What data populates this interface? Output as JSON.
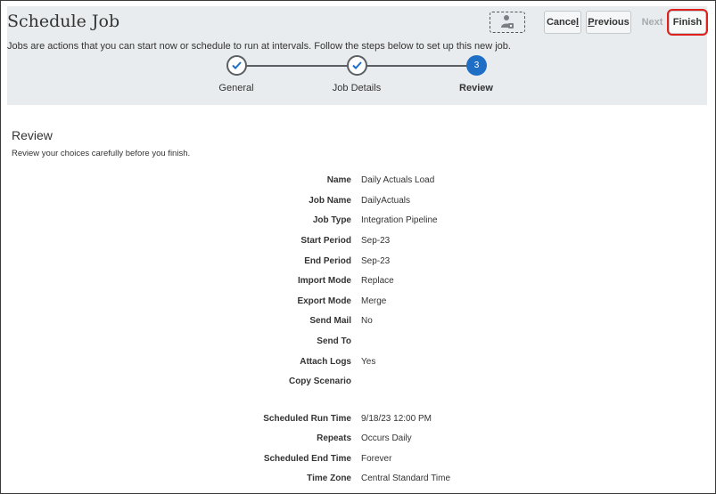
{
  "header": {
    "title": "Schedule Job",
    "description": "Jobs are actions that you can start now or schedule to run at intervals. Follow the steps below to set up this new job.",
    "context_icon": "user-lock-icon",
    "buttons": {
      "cancel": {
        "pre": "Cance",
        "key": "l"
      },
      "previous": {
        "pre": "",
        "key": "P",
        "post": "revious"
      },
      "next": "Next",
      "finish": "Finish"
    },
    "highlight_color": "#e0201c"
  },
  "train": {
    "steps": [
      {
        "label": "General",
        "state": "done"
      },
      {
        "label": "Job Details",
        "state": "done"
      },
      {
        "label": "Review",
        "state": "current",
        "number": "3"
      }
    ],
    "accent_color": "#1f6ec6"
  },
  "review": {
    "title": "Review",
    "subtitle": "Review your choices carefully before you finish.",
    "fields": [
      {
        "label": "Name",
        "value": "Daily Actuals Load"
      },
      {
        "label": "Job Name",
        "value": "DailyActuals"
      },
      {
        "label": "Job Type",
        "value": "Integration Pipeline"
      },
      {
        "label": "Start Period",
        "value": "Sep-23"
      },
      {
        "label": "End Period",
        "value": "Sep-23"
      },
      {
        "label": "Import Mode",
        "value": "Replace"
      },
      {
        "label": "Export Mode",
        "value": "Merge"
      },
      {
        "label": "Send Mail",
        "value": "No"
      },
      {
        "label": "Send To",
        "value": ""
      },
      {
        "label": "Attach Logs",
        "value": "Yes"
      },
      {
        "label": "Copy Scenario",
        "value": ""
      }
    ],
    "schedule_fields": [
      {
        "label": "Scheduled Run Time",
        "value": "9/18/23 12:00 PM"
      },
      {
        "label": "Repeats",
        "value": "Occurs Daily"
      },
      {
        "label": "Scheduled End Time",
        "value": "Forever"
      },
      {
        "label": "Time Zone",
        "value": "Central Standard Time"
      }
    ]
  }
}
